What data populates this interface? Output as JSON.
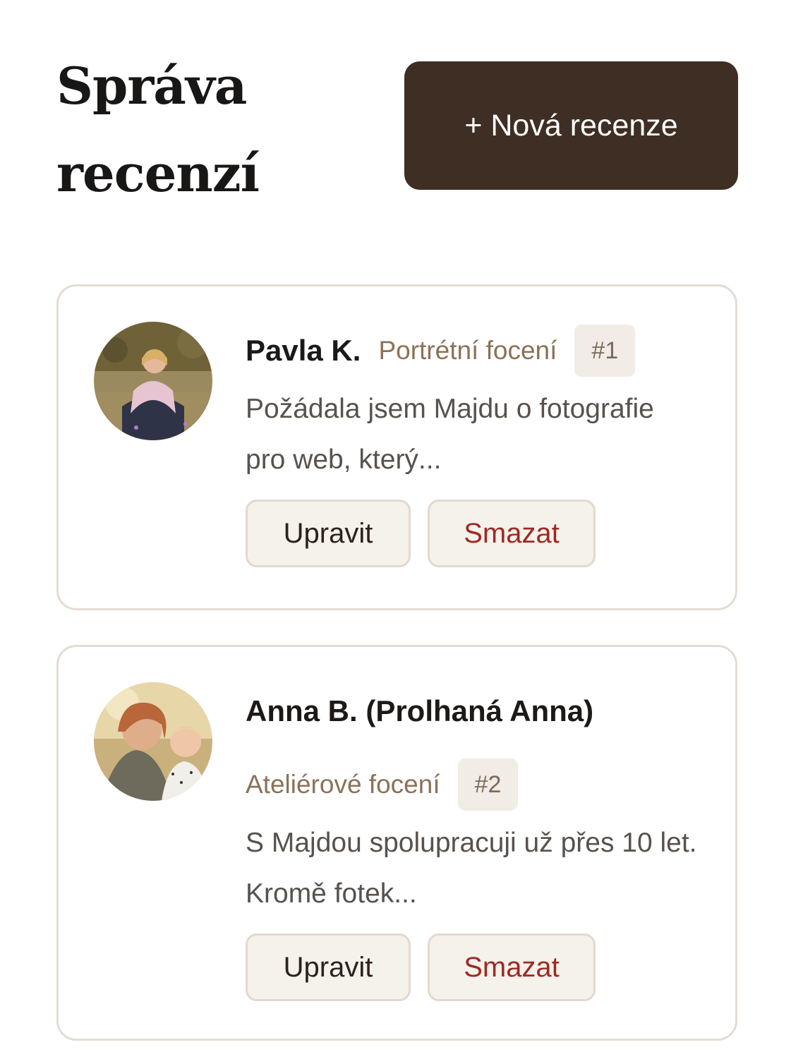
{
  "header": {
    "title": "Správa recenzí",
    "new_review_label": "+ Nová recenze"
  },
  "reviews": [
    {
      "author": "Pavla K.",
      "category": "Portrétní focení",
      "order": "#1",
      "excerpt": "Požádala jsem Majdu o fotografie pro web, který...",
      "edit_label": "Upravit",
      "delete_label": "Smazat"
    },
    {
      "author": "Anna B. (Prolhaná Anna)",
      "category": "Ateliérové focení",
      "order": "#2",
      "excerpt": "S Majdou spolupracuji už přes 10 let. Kromě fotek...",
      "edit_label": "Upravit",
      "delete_label": "Smazat"
    }
  ],
  "colors": {
    "primary_button": "#3e2e23",
    "category_text": "#8b7257",
    "delete_text": "#9d2a23",
    "card_border": "#e4dcd3"
  }
}
